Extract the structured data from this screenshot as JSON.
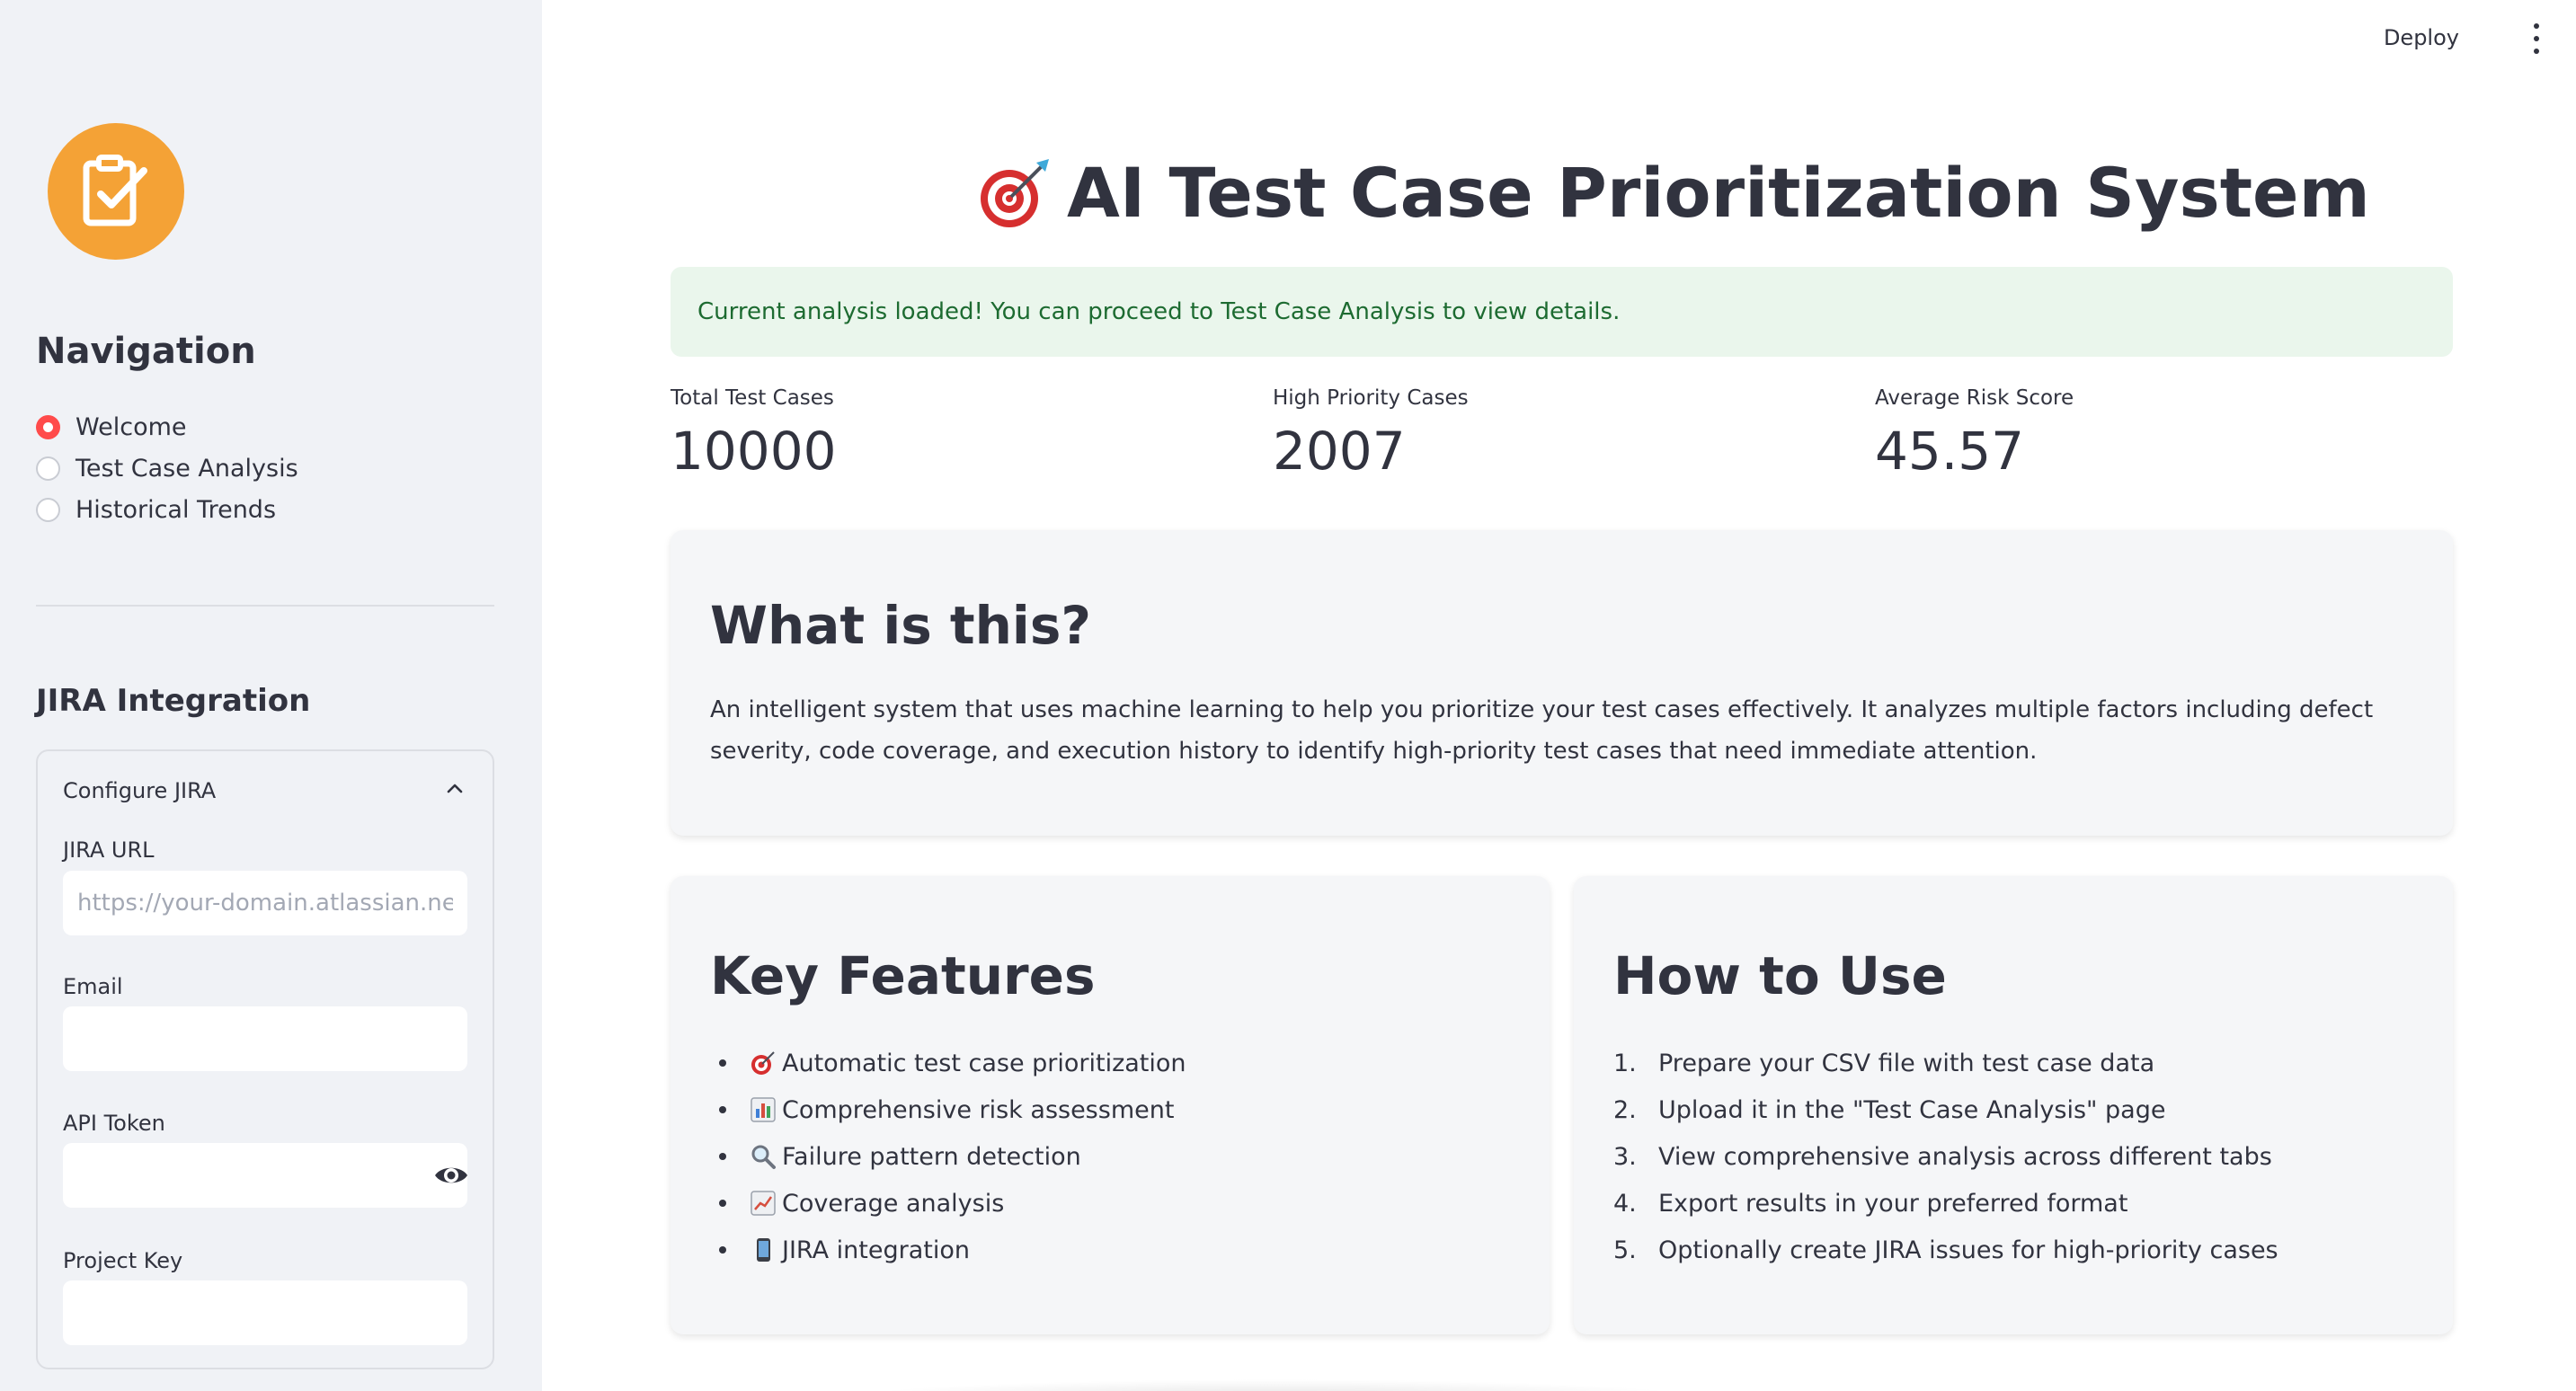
{
  "sidebar": {
    "logo_icon": "checklist-icon",
    "nav_title": "Navigation",
    "nav_items": [
      {
        "label": "Welcome",
        "selected": true
      },
      {
        "label": "Test Case Analysis",
        "selected": false
      },
      {
        "label": "Historical Trends",
        "selected": false
      }
    ],
    "jira": {
      "title": "JIRA Integration",
      "expander_label": "Configure JIRA",
      "fields": {
        "url_label": "JIRA URL",
        "url_placeholder": "https://your-domain.atlassian.net",
        "url_value": "",
        "email_label": "Email",
        "email_value": "",
        "token_label": "API Token",
        "token_value": "",
        "project_label": "Project Key",
        "project_value": ""
      }
    }
  },
  "header": {
    "deploy_label": "Deploy",
    "menu_icon": "vertical-dots-icon"
  },
  "main": {
    "title": "AI Test Case Prioritization System",
    "title_icon": "target-icon",
    "alert": "Current analysis loaded! You can proceed to Test Case Analysis to view details.",
    "metrics": [
      {
        "label": "Total Test Cases",
        "value": "10000"
      },
      {
        "label": "High Priority Cases",
        "value": "2007"
      },
      {
        "label": "Average Risk Score",
        "value": "45.57"
      }
    ],
    "what_is": {
      "heading": "What is this?",
      "text": "An intelligent system that uses machine learning to help you prioritize your test cases effectively. It analyzes multiple factors including defect severity, code coverage, and execution history to identify high-priority test cases that need immediate attention."
    },
    "features": {
      "heading": "Key Features",
      "items": [
        {
          "icon": "target-icon",
          "label": "Automatic test case prioritization"
        },
        {
          "icon": "bar-chart-icon",
          "label": "Comprehensive risk assessment"
        },
        {
          "icon": "magnifier-icon",
          "label": "Failure pattern detection"
        },
        {
          "icon": "trend-chart-icon",
          "label": "Coverage analysis"
        },
        {
          "icon": "mobile-phone-icon",
          "label": "JIRA integration"
        }
      ]
    },
    "how_to": {
      "heading": "How to Use",
      "items": [
        {
          "num": "1.",
          "label": "Prepare your CSV file with test case data"
        },
        {
          "num": "2.",
          "label": "Upload it in the \"Test Case Analysis\" page"
        },
        {
          "num": "3.",
          "label": "View comprehensive analysis across different tabs"
        },
        {
          "num": "4.",
          "label": "Export results in your preferred format"
        },
        {
          "num": "5.",
          "label": "Optionally create JIRA issues for high-priority cases"
        }
      ]
    }
  },
  "colors": {
    "accent": "#ff4b4b",
    "logo": "#f4a236",
    "alert_bg": "#eaf6ec",
    "alert_text": "#1d6b31"
  }
}
